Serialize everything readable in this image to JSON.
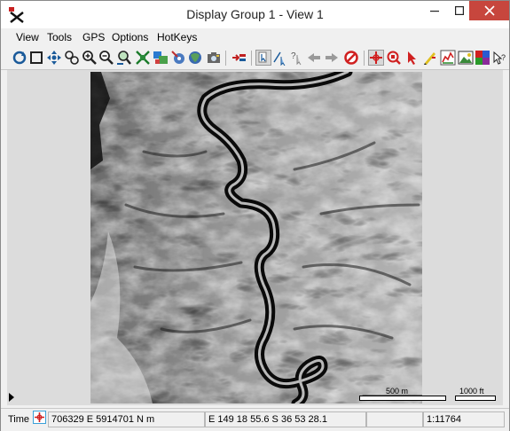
{
  "window": {
    "title": "Display Group 1 - View 1"
  },
  "menu": [
    "View",
    "Tools",
    "GPS",
    "Options",
    "HotKeys"
  ],
  "toolbar": {
    "tools": [
      "redraw-icon",
      "full-view-icon",
      "pan-icon",
      "zoom-box-icon",
      "zoom-in-icon",
      "zoom-out-icon",
      "zoom-fit-icon",
      "zoom-extent-icon",
      "layer-controls-icon",
      "gps-icon",
      "snapshot-icon",
      "add-layer-icon",
      "select-element-icon",
      "multi-select-icon",
      "query-icon",
      "back-icon",
      "forward-icon",
      "cancel-icon",
      "position-icon",
      "zoom-target-icon",
      "pointer-icon",
      "sketch-icon",
      "color-balance-icon",
      "image-icon",
      "palette-icon",
      "help-icon"
    ]
  },
  "scale": {
    "metric": "500 m",
    "imperial": "1000 ft"
  },
  "status": {
    "time_label": "Time",
    "coords_projected": "706329 E  5914701 N m",
    "coords_geographic": "E 149 18 55.6  S 36 53 28.1",
    "scale_ratio": "1:11764"
  },
  "colors": {
    "close_button": "#c7463d",
    "titlebar": "#ffffff",
    "chrome": "#f0f0f0"
  }
}
